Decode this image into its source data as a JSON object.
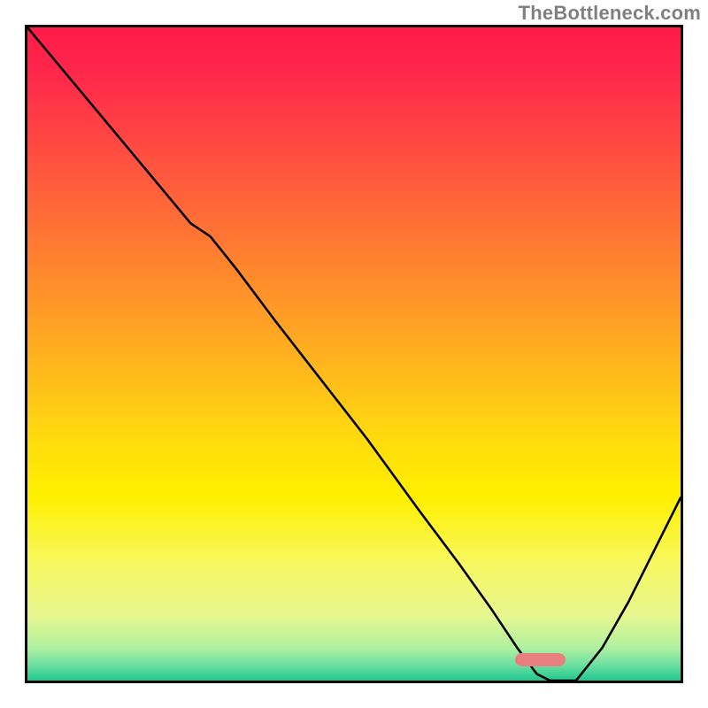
{
  "attribution": "TheBottleneck.com",
  "chart_data": {
    "type": "line",
    "title": "",
    "xlabel": "",
    "ylabel": "",
    "xlim": [
      0,
      100
    ],
    "ylim": [
      0,
      100
    ],
    "x": [
      0,
      5,
      10,
      15,
      20,
      25,
      28,
      32,
      38,
      45,
      52,
      60,
      66,
      71,
      75,
      78,
      80,
      84,
      88,
      92,
      96,
      100
    ],
    "values": [
      100,
      94,
      88,
      82,
      76,
      70,
      68,
      63,
      55,
      46,
      37,
      26,
      18,
      11,
      5,
      1,
      0,
      0,
      5,
      12,
      20,
      28
    ],
    "gradient_stops": [
      {
        "offset": 0.0,
        "color": "#ff1a4a"
      },
      {
        "offset": 0.08,
        "color": "#ff2a4a"
      },
      {
        "offset": 0.2,
        "color": "#ff5040"
      },
      {
        "offset": 0.35,
        "color": "#ff8030"
      },
      {
        "offset": 0.5,
        "color": "#ffb020"
      },
      {
        "offset": 0.62,
        "color": "#ffd810"
      },
      {
        "offset": 0.72,
        "color": "#fff000"
      },
      {
        "offset": 0.82,
        "color": "#f8f860"
      },
      {
        "offset": 0.9,
        "color": "#e8f890"
      },
      {
        "offset": 0.95,
        "color": "#b0f0a0"
      },
      {
        "offset": 0.975,
        "color": "#70e0a0"
      },
      {
        "offset": 1.0,
        "color": "#20c890"
      }
    ],
    "optimal_marker": {
      "x_center_frac": 0.785,
      "y_frac": 0.968,
      "width_frac": 0.078,
      "color": "#e88080"
    }
  }
}
